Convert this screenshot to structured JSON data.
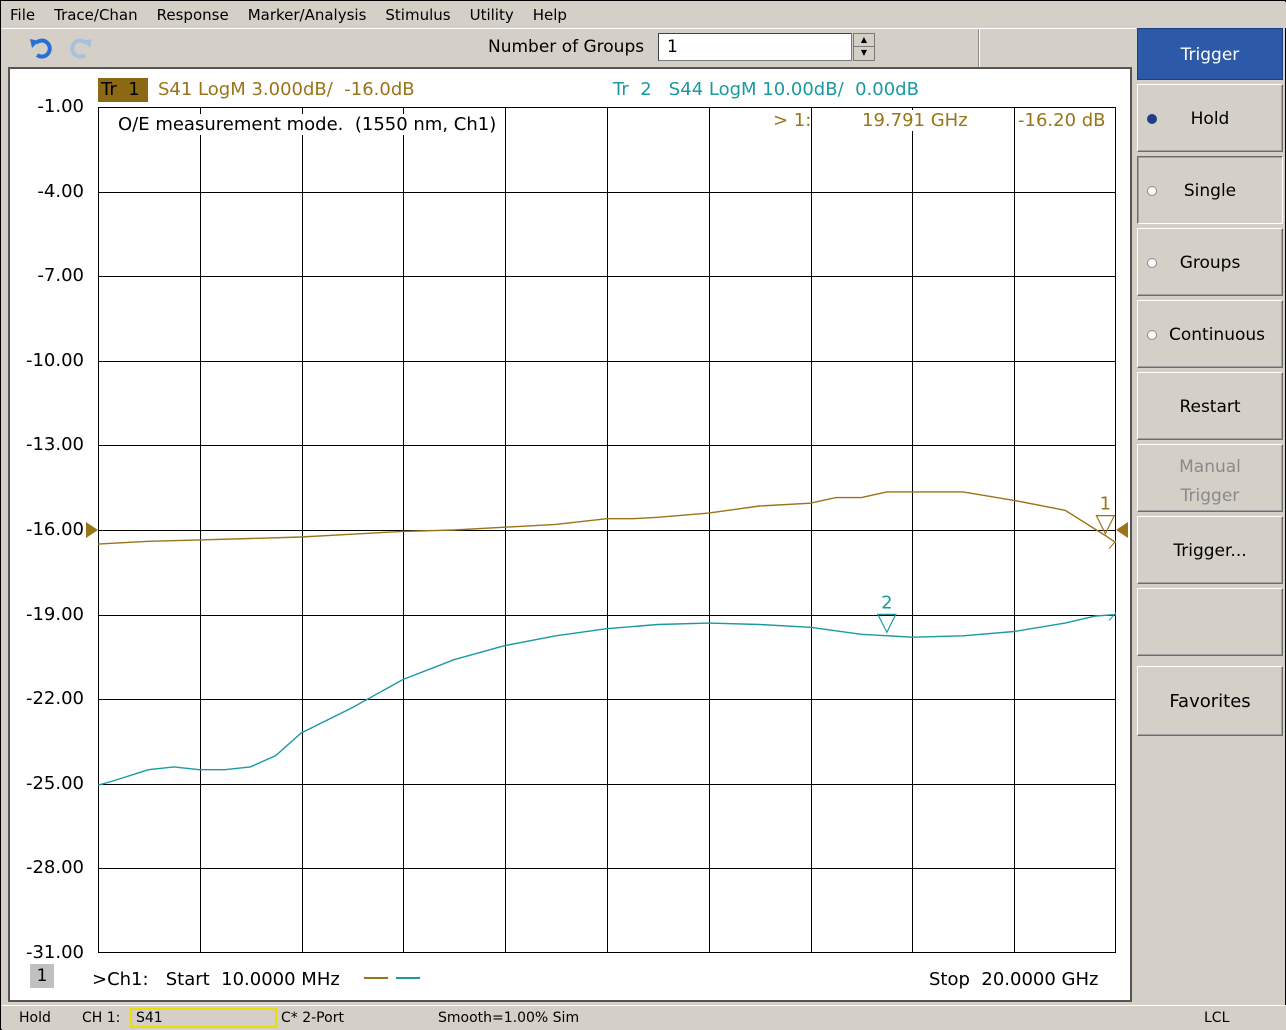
{
  "menu": [
    "File",
    "Trace/Chan",
    "Response",
    "Marker/Analysis",
    "Stimulus",
    "Utility",
    "Help"
  ],
  "toolbar": {
    "undo_icon": "undo-arrow-icon",
    "redo_icon": "redo-arrow-icon",
    "groups_label": "Number of Groups",
    "groups_value": "1"
  },
  "traces": {
    "tr1_badge": "Tr  1",
    "tr1_text": "S41 LogM 3.000dB/  -16.0dB",
    "tr1_color": "#9a7418",
    "tr2_text": "Tr  2   S44 LogM 10.00dB/  0.00dB",
    "tr2_color": "#1a9aa0"
  },
  "y_axis_labels": [
    "-1.00",
    "-4.00",
    "-7.00",
    "-10.00",
    "-13.00",
    "-16.00",
    "-19.00",
    "-22.00",
    "-25.00",
    "-28.00",
    "-31.00"
  ],
  "mode_text": "O/E measurement mode.  (1550 nm, Ch1)",
  "marker_readout": {
    "id": "> 1:",
    "freq": "19.791 GHz",
    "value": "-16.20 dB"
  },
  "marker_labels": {
    "m1": "1",
    "m2": "2"
  },
  "footer": {
    "channel_number": "1",
    "start": ">Ch1:   Start  10.0000 MHz",
    "stop": "Stop  20.0000 GHz"
  },
  "softkeys": {
    "title": "Trigger",
    "hold": "Hold",
    "single": "Single",
    "groups": "Groups",
    "continuous": "Continuous",
    "restart": "Restart",
    "manual_line1": "Manual",
    "manual_line2": "Trigger",
    "trigger_dots": "Trigger...",
    "favorites": "Favorites",
    "selected": "Hold"
  },
  "status_bar": {
    "state": "Hold",
    "channel": "CH 1:",
    "param": "S41",
    "correction": "C* 2-Port",
    "smooth": "Smooth=1.00% Sim",
    "remote": "LCL"
  },
  "chart_data": {
    "type": "line",
    "x_start_ghz": 0.01,
    "x_stop_ghz": 20.0,
    "x_divisions": 10,
    "y_divisions": 10,
    "ylim": [
      -31.0,
      -1.0
    ],
    "grid": true,
    "series": [
      {
        "name": "S41",
        "color": "#9a7418",
        "x": [
          0.01,
          0.5,
          1,
          2,
          3,
          4,
          5,
          6,
          7,
          8,
          9,
          10,
          10.5,
          11,
          12,
          13,
          14,
          14.5,
          15,
          15.5,
          16,
          17,
          18,
          19,
          19.791,
          20
        ],
        "values": [
          -16.5,
          -16.45,
          -16.4,
          -16.35,
          -16.3,
          -16.25,
          -16.15,
          -16.05,
          -16.0,
          -15.9,
          -15.8,
          -15.6,
          -15.6,
          -15.55,
          -15.4,
          -15.15,
          -15.05,
          -14.85,
          -14.85,
          -14.65,
          -14.65,
          -14.65,
          -14.95,
          -15.3,
          -16.2,
          -16.45
        ]
      },
      {
        "name": "S44",
        "color": "#1a9aa0",
        "x": [
          0.01,
          0.3,
          1,
          1.5,
          2,
          2.5,
          3,
          3.5,
          4,
          5,
          6,
          7,
          8,
          9,
          10,
          11,
          12,
          13,
          14,
          15,
          16,
          17,
          18,
          19,
          19.6,
          20
        ],
        "values": [
          -25.05,
          -24.9,
          -24.5,
          -24.4,
          -24.5,
          -24.5,
          -24.4,
          -24.0,
          -23.2,
          -22.3,
          -21.3,
          -20.6,
          -20.1,
          -19.75,
          -19.5,
          -19.35,
          -19.3,
          -19.35,
          -19.45,
          -19.7,
          -19.8,
          -19.75,
          -19.6,
          -19.3,
          -19.05,
          -19.0
        ]
      }
    ],
    "markers": [
      {
        "id": "1",
        "series": "S41",
        "x": 19.791,
        "value": -16.2
      },
      {
        "id": "2",
        "series": "S44",
        "x": 15.5,
        "value": -19.7
      }
    ],
    "reference_level": -16.0
  }
}
